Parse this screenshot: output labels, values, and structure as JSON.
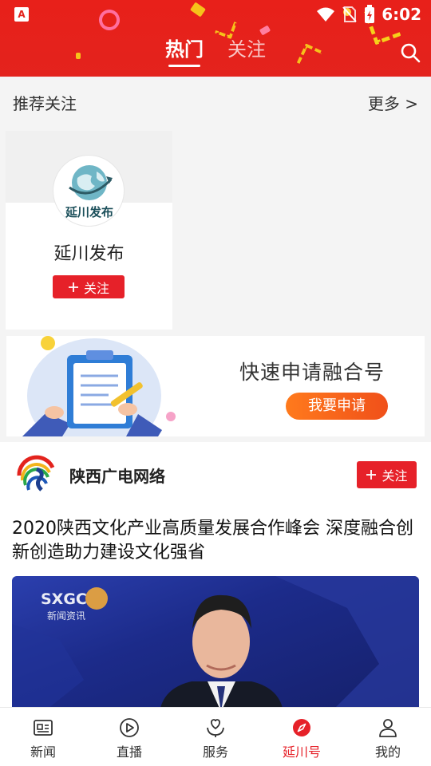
{
  "status_bar": {
    "app_badge": "A",
    "time": "6:02"
  },
  "header": {
    "tabs": [
      {
        "label": "热门",
        "active": true
      },
      {
        "label": "关注",
        "active": false
      }
    ],
    "search_icon": "search-icon"
  },
  "recommend": {
    "title": "推荐关注",
    "more_label": "更多 >",
    "cards": [
      {
        "name": "延川发布",
        "avatar_text": "延川发布",
        "follow_label": "关注"
      }
    ]
  },
  "banner": {
    "title": "快速申请融合号",
    "button_label": "我要申请"
  },
  "feed": {
    "items": [
      {
        "source": "陕西广电网络",
        "follow_label": "关注",
        "title": "2020陕西文化产业高质量发展合作峰会 深度融合创新创造助力建设文化强省",
        "image_overlay": {
          "logo": "SXGC",
          "caption": "新闻资讯"
        }
      }
    ]
  },
  "bottom_nav": {
    "items": [
      {
        "label": "新闻",
        "icon": "news-icon",
        "active": false
      },
      {
        "label": "直播",
        "icon": "play-icon",
        "active": false
      },
      {
        "label": "服务",
        "icon": "service-icon",
        "active": false
      },
      {
        "label": "延川号",
        "icon": "compass-icon",
        "active": true
      },
      {
        "label": "我的",
        "icon": "user-icon",
        "active": false
      }
    ]
  },
  "colors": {
    "brand_red": "#e3231d",
    "follow_red": "#e62129",
    "banner_orange": "#f0501a"
  }
}
